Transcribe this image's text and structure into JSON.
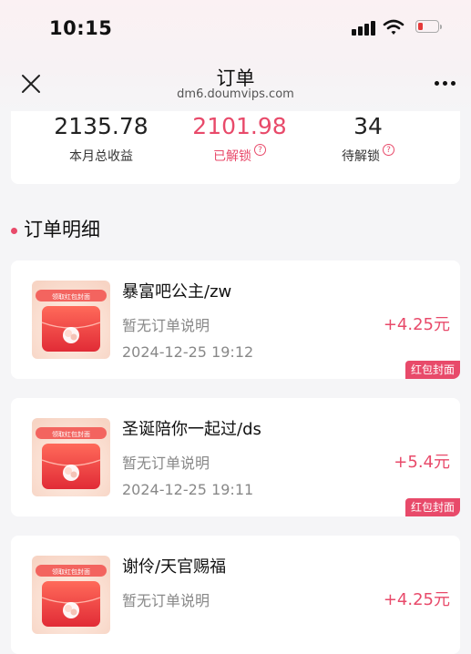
{
  "status_bar": {
    "time": "10:15"
  },
  "nav": {
    "title": "订单",
    "url": "dm6.doumvips.com"
  },
  "stats": [
    {
      "value": "2135.78",
      "label": "本月总收益",
      "highlight": false,
      "help": false
    },
    {
      "value": "2101.98",
      "label": "已解锁",
      "highlight": true,
      "help": true
    },
    {
      "value": "34",
      "label": "待解锁",
      "highlight": false,
      "help": true
    }
  ],
  "section": {
    "title": "订单明细"
  },
  "thumbnail_caption": "领取红包封面",
  "orders": [
    {
      "name": "暴富吧公主/zw",
      "desc": "暂无订单说明",
      "time": "2024-12-25 19:12",
      "amount": "+4.25元",
      "tag": "红包封面"
    },
    {
      "name": "圣诞陪你一起过/ds",
      "desc": "暂无订单说明",
      "time": "2024-12-25 19:11",
      "amount": "+5.4元",
      "tag": "红包封面"
    },
    {
      "name": "谢伶/天官赐福",
      "desc": "暂无订单说明",
      "time": "",
      "amount": "+4.25元",
      "tag": ""
    }
  ],
  "colors": {
    "accent": "#e84a6a",
    "thumb_red": "#e8343c"
  },
  "icons": {
    "close": "close-icon",
    "more": "more-icon",
    "help": "help-icon",
    "signal": "signal-icon",
    "wifi": "wifi-icon",
    "battery": "battery-icon"
  }
}
